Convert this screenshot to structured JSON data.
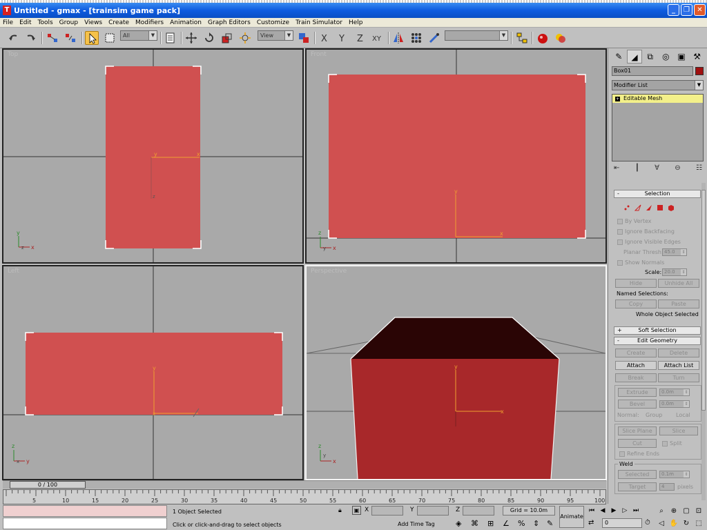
{
  "window": {
    "title": "Untitled - gmax - [trainsim game pack]",
    "icon_letter": "T",
    "buttons": [
      "_",
      "❐",
      "✕"
    ]
  },
  "menu": [
    "File",
    "Edit",
    "Tools",
    "Group",
    "Views",
    "Create",
    "Modifiers",
    "Animation",
    "Graph Editors",
    "Customize",
    "Train Simulator",
    "Help"
  ],
  "toolbar": {
    "selection_filter": "All",
    "ref_coord": "View",
    "named_selection": ""
  },
  "viewports": {
    "top": {
      "label": "Top"
    },
    "front": {
      "label": "Front"
    },
    "left": {
      "label": "Left"
    },
    "perspective": {
      "label": "Perspective"
    }
  },
  "axes": {
    "x": "x",
    "y": "y",
    "z": "z"
  },
  "command_panel": {
    "tabs": [
      "create-icon",
      "modify-icon",
      "hierarchy-icon",
      "motion-icon",
      "display-icon",
      "utilities-icon"
    ],
    "object_name": "Box01",
    "object_color": "#a01010",
    "modifier_list": "Modifier List",
    "stack_item": "Editable Mesh",
    "selection": {
      "header": "Selection",
      "by_vertex": "By Vertex",
      "ignore_backfacing": "Ignore Backfacing",
      "ignore_visible_edges": "Ignore Visible Edges",
      "planar_thresh_label": "Planar Thresh:",
      "planar_thresh_value": "45.0",
      "show_normals": "Show Normals",
      "scale_label": "Scale:",
      "scale_value": "20.0",
      "hide": "Hide",
      "unhide_all": "Unhide All",
      "named_selections": "Named Selections:",
      "copy": "Copy",
      "paste": "Paste",
      "status": "Whole Object Selected"
    },
    "soft_selection": {
      "header": "Soft Selection",
      "sign": "+"
    },
    "edit_geometry": {
      "header": "Edit Geometry",
      "sign": "-",
      "create": "Create",
      "delete": "Delete",
      "attach": "Attach",
      "attach_list": "Attach List",
      "break": "Break",
      "turn": "Turn",
      "extrude": "Extrude",
      "extrude_value": "0.0m",
      "bevel": "Bevel",
      "bevel_value": "0.0m",
      "normal": "Normal:",
      "group": "Group",
      "local": "Local",
      "slice_plane": "Slice Plane",
      "slice": "Slice",
      "cut": "Cut",
      "split": "Split",
      "refine_ends": "Refine Ends",
      "weld": "Weld",
      "selected": "Selected",
      "selected_value": "0.1m",
      "target": "Target",
      "target_value": "4",
      "pixels": "pixels"
    }
  },
  "timeline": {
    "slider": "0 / 100",
    "ticks": [
      "5",
      "10",
      "15",
      "20",
      "25",
      "30",
      "35",
      "40",
      "45",
      "50",
      "55",
      "60",
      "65",
      "70",
      "75",
      "80",
      "85",
      "90",
      "95",
      "100"
    ]
  },
  "status_bar": {
    "selected": "1 Object Selected",
    "prompt": "Click or click-and-drag to select objects",
    "x_label": "X",
    "y_label": "Y",
    "z_label": "Z",
    "grid": "Grid = 10.0m",
    "animate": "Animate",
    "add_time_tag": "Add Time Tag",
    "frame": "0"
  },
  "colors": {
    "object_fill": "#d05050",
    "object_side": "#a8282a",
    "object_top": "#2a0505",
    "gizmo": "#f0a030"
  }
}
